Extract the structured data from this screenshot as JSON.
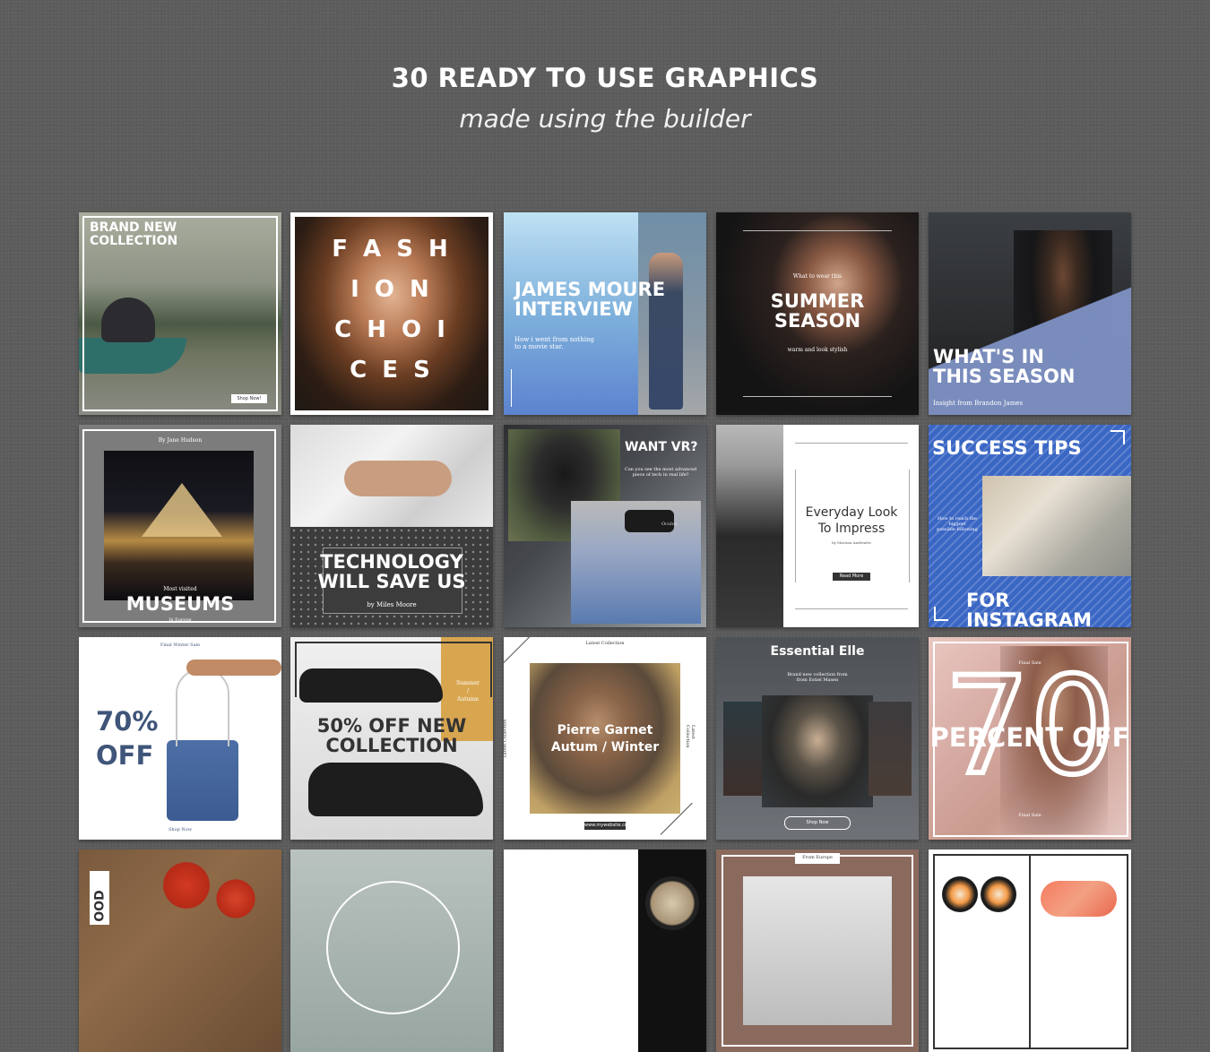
{
  "header": {
    "title": "30 READY TO USE GRAPHICS",
    "subtitle": "made using the builder"
  },
  "tiles": {
    "t1": {
      "headline": "BRAND NEW\nCOLLECTION",
      "button": "Shop Now!"
    },
    "t2": {
      "letters": [
        "F A S H",
        "I O N",
        "C H O I",
        "C E S"
      ]
    },
    "t3": {
      "headline": "JAMES MOURE\nINTERVIEW",
      "caption": "How i went from nothing\nto a movie star."
    },
    "t4": {
      "kicker": "What to wear this",
      "headline": "SUMMER\nSEASON",
      "caption": "warm and look stylish"
    },
    "t5": {
      "headline": "WHAT'S IN\nTHIS SEASON",
      "caption": "Insight from Brandon James"
    },
    "t6": {
      "byline": "By Jane Hudson",
      "kicker": "Most visited",
      "headline": "MUSEUMS",
      "caption": "In Europe"
    },
    "t7": {
      "headline": "TECHNOLOGY\nWILL SAVE US",
      "byline": "by Miles Moore"
    },
    "t8": {
      "headline": "WANT VR?",
      "caption": "Can you see the most advanced\npiece of tech in real life?",
      "brand": "Oculus"
    },
    "t9": {
      "headline": "Everyday Look\nTo Impress",
      "byline": "by Marissa Andreatte",
      "button": "Read More"
    },
    "t10": {
      "headline_top": "SUCCESS TIPS",
      "caption": "How to reach the\nbiggest\npossible following",
      "headline_bottom": "FOR INSTAGRAM"
    },
    "t11": {
      "kicker": "Final Winter Sale",
      "headline": "70%\nOFF",
      "footer": "Shop Now"
    },
    "t12": {
      "side": "Summer\n/\nAutumn",
      "headline": "50% OFF NEW\nCOLLECTION"
    },
    "t13": {
      "kicker": "Latest Collection",
      "headline": "Pierre Garnet\nAutum / Winter",
      "button": "www.mywebsite.com",
      "side": "Latest Collection"
    },
    "t14": {
      "headline": "Essential Elle",
      "caption": "Brand new collection from\nfrom Estiel Masen",
      "button": "Shop Now"
    },
    "t15": {
      "big_number": "70",
      "headline": "PERCENT OFF",
      "kicker": "Final Sale",
      "footer": "Final Sale"
    },
    "t16": {
      "side": "OOD"
    },
    "t19": {
      "kicker": "From Europe"
    }
  },
  "colors": {
    "background": "#5c5c5c",
    "accent_blue": "#3a66c4",
    "accent_gold": "#d9a650",
    "navy": "#3f5579"
  },
  "icons": [
    "oculus-headset-photo",
    "handbag-photo",
    "shoe-photo",
    "pyramid-photo"
  ]
}
